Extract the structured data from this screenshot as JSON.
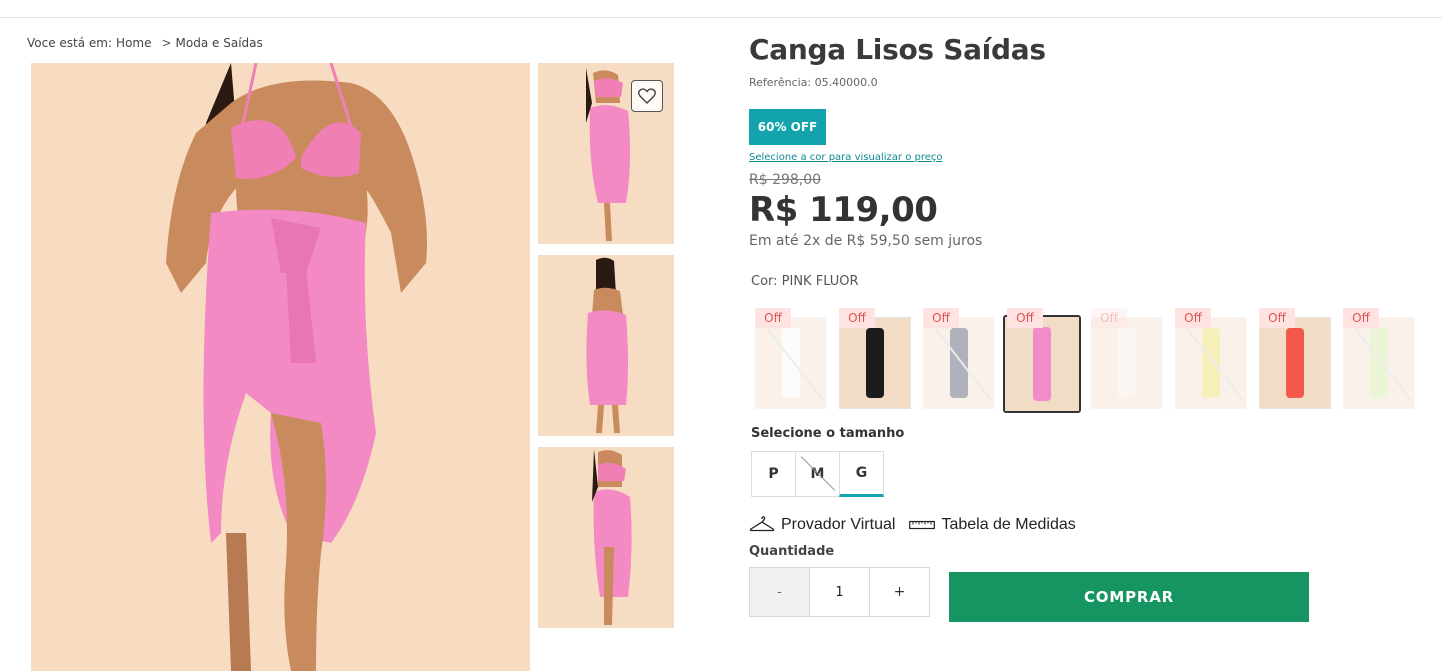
{
  "breadcrumb": {
    "prefix": "Voce está em:",
    "items": [
      "Home",
      "Moda e Saídas"
    ],
    "separator": ">"
  },
  "product": {
    "title": "Canga Lisos Saídas",
    "reference": "Referência: 05.40000.0",
    "discount_badge": "60% OFF",
    "select_color_hint": "Selecione a cor para visualizar o preço",
    "old_price": "R$ 298,00",
    "price": "R$ 119,00",
    "installments": "Em até 2x de R$ 59,50 sem juros",
    "color_label": "Cor: PINK FLUOR"
  },
  "swatches": [
    {
      "tag": "Off",
      "color": "white",
      "hex": "#f7f7f2",
      "unavailable": true
    },
    {
      "tag": "Off",
      "color": "black",
      "hex": "#1c1c1c",
      "unavailable": false
    },
    {
      "tag": "Off",
      "color": "navy",
      "hex": "#1d2240",
      "unavailable": true
    },
    {
      "tag": "Off",
      "color": "pink",
      "hex": "#f08cc8",
      "selected": true
    },
    {
      "tag": "Off",
      "color": "cream",
      "hex": "#f5e6dc",
      "faded": true
    },
    {
      "tag": "Off",
      "color": "yellow",
      "hex": "#e9d23a",
      "unavailable": true
    },
    {
      "tag": "Off",
      "color": "coral",
      "hex": "#f2594a",
      "unavailable": false
    },
    {
      "tag": "Off",
      "color": "lime",
      "hex": "#c6e88a",
      "unavailable": true
    }
  ],
  "sizes": {
    "title": "Selecione o tamanho",
    "options": [
      {
        "label": "P"
      },
      {
        "label": "M",
        "disabled": true
      },
      {
        "label": "G",
        "active": true
      }
    ]
  },
  "tools": {
    "virtual_fitting": "Provador Virtual",
    "size_chart": "Tabela de Medidas"
  },
  "quantity": {
    "label": "Quantidade",
    "minus": "-",
    "value": "1",
    "plus": "+"
  },
  "buy_button": "COMPRAR",
  "colors": {
    "accent": "#12a3ad",
    "buy": "#169461",
    "off_tag_bg": "#ffe3e3",
    "off_tag_text": "#d9534f"
  },
  "icons": [
    "heart-icon",
    "hanger-icon",
    "ruler-icon"
  ]
}
